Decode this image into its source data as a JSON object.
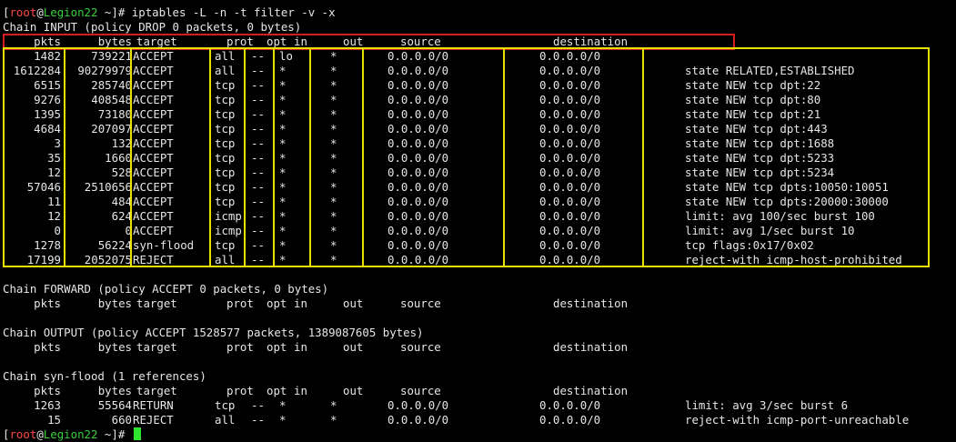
{
  "colors": {
    "background": "#000000",
    "text": "#e6e6e6",
    "prompt_user": "#ff4848",
    "prompt_host": "#36d13a",
    "cursor": "#2fe42f",
    "highlight_header": "#d61d1d",
    "highlight_rules": "#e8e000"
  },
  "prompt": {
    "open": "[",
    "user": "root",
    "at": "@",
    "host": "Legion22",
    "path": " ~]# "
  },
  "command": "iptables -L -n -t filter -v -x",
  "headers": {
    "pkts": "pkts",
    "bytes": "bytes",
    "target": "target",
    "prot": "prot",
    "opt": "opt",
    "in": "in",
    "out": "out",
    "source": "source",
    "destination": "destination"
  },
  "chains": [
    {
      "title": "Chain INPUT (policy DROP 0 packets, 0 bytes)",
      "rules": [
        {
          "pkts": "1482",
          "bytes": "739221",
          "target": "ACCEPT",
          "prot": "all",
          "opt": "--",
          "in": "lo",
          "out": "*",
          "source": "0.0.0.0/0",
          "destination": "0.0.0.0/0",
          "extra": ""
        },
        {
          "pkts": "1612284",
          "bytes": "90279979",
          "target": "ACCEPT",
          "prot": "all",
          "opt": "--",
          "in": "*",
          "out": "*",
          "source": "0.0.0.0/0",
          "destination": "0.0.0.0/0",
          "extra": "state RELATED,ESTABLISHED"
        },
        {
          "pkts": "6515",
          "bytes": "285740",
          "target": "ACCEPT",
          "prot": "tcp",
          "opt": "--",
          "in": "*",
          "out": "*",
          "source": "0.0.0.0/0",
          "destination": "0.0.0.0/0",
          "extra": "state NEW tcp dpt:22"
        },
        {
          "pkts": "9276",
          "bytes": "408548",
          "target": "ACCEPT",
          "prot": "tcp",
          "opt": "--",
          "in": "*",
          "out": "*",
          "source": "0.0.0.0/0",
          "destination": "0.0.0.0/0",
          "extra": "state NEW tcp dpt:80"
        },
        {
          "pkts": "1395",
          "bytes": "73180",
          "target": "ACCEPT",
          "prot": "tcp",
          "opt": "--",
          "in": "*",
          "out": "*",
          "source": "0.0.0.0/0",
          "destination": "0.0.0.0/0",
          "extra": "state NEW tcp dpt:21"
        },
        {
          "pkts": "4684",
          "bytes": "207097",
          "target": "ACCEPT",
          "prot": "tcp",
          "opt": "--",
          "in": "*",
          "out": "*",
          "source": "0.0.0.0/0",
          "destination": "0.0.0.0/0",
          "extra": "state NEW tcp dpt:443"
        },
        {
          "pkts": "3",
          "bytes": "132",
          "target": "ACCEPT",
          "prot": "tcp",
          "opt": "--",
          "in": "*",
          "out": "*",
          "source": "0.0.0.0/0",
          "destination": "0.0.0.0/0",
          "extra": "state NEW tcp dpt:1688"
        },
        {
          "pkts": "35",
          "bytes": "1660",
          "target": "ACCEPT",
          "prot": "tcp",
          "opt": "--",
          "in": "*",
          "out": "*",
          "source": "0.0.0.0/0",
          "destination": "0.0.0.0/0",
          "extra": "state NEW tcp dpt:5233"
        },
        {
          "pkts": "12",
          "bytes": "528",
          "target": "ACCEPT",
          "prot": "tcp",
          "opt": "--",
          "in": "*",
          "out": "*",
          "source": "0.0.0.0/0",
          "destination": "0.0.0.0/0",
          "extra": "state NEW tcp dpt:5234"
        },
        {
          "pkts": "57046",
          "bytes": "2510656",
          "target": "ACCEPT",
          "prot": "tcp",
          "opt": "--",
          "in": "*",
          "out": "*",
          "source": "0.0.0.0/0",
          "destination": "0.0.0.0/0",
          "extra": "state NEW tcp dpts:10050:10051"
        },
        {
          "pkts": "11",
          "bytes": "484",
          "target": "ACCEPT",
          "prot": "tcp",
          "opt": "--",
          "in": "*",
          "out": "*",
          "source": "0.0.0.0/0",
          "destination": "0.0.0.0/0",
          "extra": "state NEW tcp dpts:20000:30000"
        },
        {
          "pkts": "12",
          "bytes": "624",
          "target": "ACCEPT",
          "prot": "icmp",
          "opt": "--",
          "in": "*",
          "out": "*",
          "source": "0.0.0.0/0",
          "destination": "0.0.0.0/0",
          "extra": "limit: avg 100/sec burst 100"
        },
        {
          "pkts": "0",
          "bytes": "0",
          "target": "ACCEPT",
          "prot": "icmp",
          "opt": "--",
          "in": "*",
          "out": "*",
          "source": "0.0.0.0/0",
          "destination": "0.0.0.0/0",
          "extra": "limit: avg 1/sec burst 10"
        },
        {
          "pkts": "1278",
          "bytes": "56224",
          "target": "syn-flood",
          "prot": "tcp",
          "opt": "--",
          "in": "*",
          "out": "*",
          "source": "0.0.0.0/0",
          "destination": "0.0.0.0/0",
          "extra": "tcp flags:0x17/0x02"
        },
        {
          "pkts": "17199",
          "bytes": "2052075",
          "target": "REJECT",
          "prot": "all",
          "opt": "--",
          "in": "*",
          "out": "*",
          "source": "0.0.0.0/0",
          "destination": "0.0.0.0/0",
          "extra": "reject-with icmp-host-prohibited"
        }
      ]
    },
    {
      "title": "Chain FORWARD (policy ACCEPT 0 packets, 0 bytes)",
      "rules": []
    },
    {
      "title": "Chain OUTPUT (policy ACCEPT 1528577 packets, 1389087605 bytes)",
      "rules": []
    },
    {
      "title": "Chain syn-flood (1 references)",
      "rules": [
        {
          "pkts": "1263",
          "bytes": "55564",
          "target": "RETURN",
          "prot": "tcp",
          "opt": "--",
          "in": "*",
          "out": "*",
          "source": "0.0.0.0/0",
          "destination": "0.0.0.0/0",
          "extra": "limit: avg 3/sec burst 6"
        },
        {
          "pkts": "15",
          "bytes": "660",
          "target": "REJECT",
          "prot": "all",
          "opt": "--",
          "in": "*",
          "out": "*",
          "source": "0.0.0.0/0",
          "destination": "0.0.0.0/0",
          "extra": "reject-with icmp-port-unreachable"
        }
      ]
    }
  ]
}
